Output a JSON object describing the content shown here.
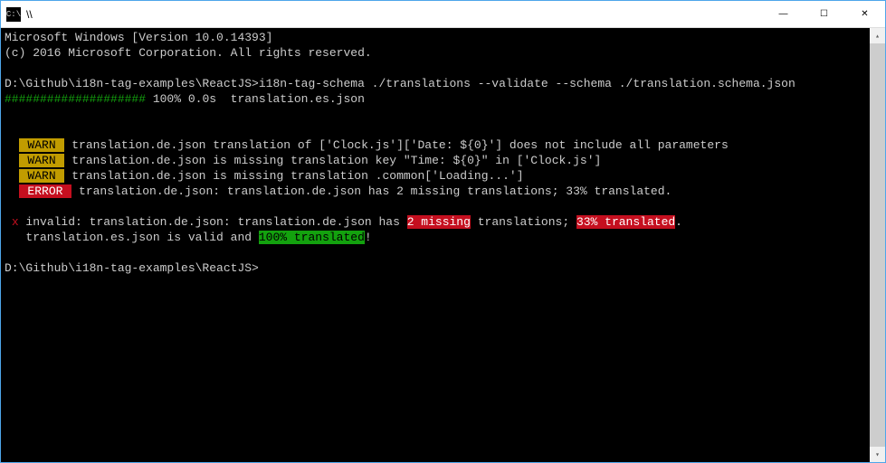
{
  "titlebar": {
    "icon_glyph": "C:\\",
    "title": "\\\\",
    "minimize": "—",
    "maximize": "☐",
    "close": "✕"
  },
  "terminal": {
    "line1": "Microsoft Windows [Version 10.0.14393]",
    "line2": "(c) 2016 Microsoft Corporation. All rights reserved.",
    "prompt1_path": "D:\\Github\\i18n-tag-examples\\ReactJS>",
    "prompt1_cmd": "i18n-tag-schema ./translations --validate --schema ./translation.schema.json",
    "progress_bar": "####################",
    "progress_text": " 100% 0.0s  translation.es.json",
    "warn_label": " WARN ",
    "error_label": " ERROR ",
    "warn1": " translation.de.json translation of ['Clock.js']['Date: ${0}'] does not include all parameters",
    "warn2": " translation.de.json is missing translation key \"Time: ${0}\" in ['Clock.js']",
    "warn3": " translation.de.json is missing translation .common['Loading...']",
    "error1": " translation.de.json: translation.de.json has 2 missing translations; 33% translated.",
    "invalid_mark": "x",
    "invalid_prefix": " invalid: translation.de.json: translation.de.json has ",
    "invalid_missing": "2 missing",
    "invalid_mid": " translations; ",
    "invalid_pct": "33% translated",
    "invalid_suffix": ".",
    "valid_prefix": "   translation.es.json is valid and ",
    "valid_pct": "100% translated",
    "valid_suffix": "!",
    "prompt2_path": "D:\\Github\\i18n-tag-examples\\ReactJS>",
    "scroll_up": "▴",
    "scroll_down": "▾"
  }
}
